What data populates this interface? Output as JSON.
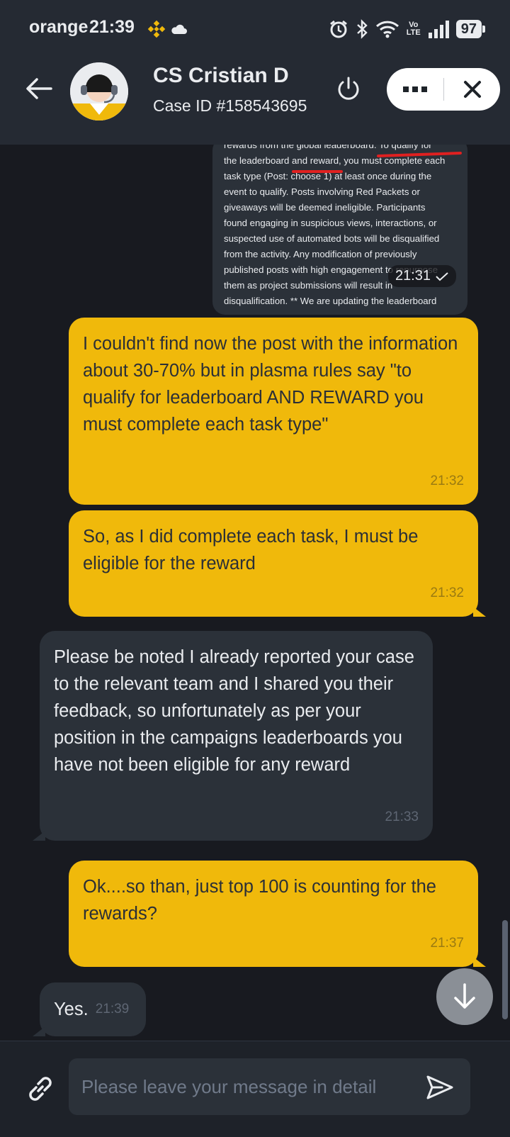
{
  "status_bar": {
    "carrier": "orange",
    "time": "21:39",
    "volte_line1": "Vo",
    "volte_line2": "LTE",
    "battery": "97",
    "icons": [
      "binance-icon",
      "cloud-icon",
      "alarm-icon",
      "bluetooth-icon",
      "wifi-icon",
      "signal-icon"
    ]
  },
  "header": {
    "agent_name": "CS Cristian D",
    "case_id": "Case ID #158543695",
    "icons": [
      "back-arrow-icon",
      "power-icon",
      "more-icon",
      "close-icon"
    ]
  },
  "messages": {
    "image_snippet": {
      "text": "rewards from the global leaderboard. To qualify for\nthe leaderboard and reward, you must complete each\ntask type (Post: choose 1) at least once during the\nevent to qualify. Posts involving Red Packets or\ngiveaways will be deemed ineligible. Participants\nfound engaging in suspicious views, interactions, or\nsuspected use of automated bots will be disqualified\nfrom the activity. Any modification of previously\npublished posts with high engagement to repurpose\nthem as project submissions will result in\ndisqualification. ** We are updating the leaderboard",
      "time": "21:31"
    },
    "m1": {
      "text": "I couldn't find now the post with the information about 30-70% but in plasma rules say \"to qualify for leaderboard AND REWARD you must complete each task type\"",
      "time": "21:32"
    },
    "m2": {
      "text": "So, as I did complete each task, I must be eligible for the reward",
      "time": "21:32"
    },
    "m3": {
      "text": "Please be noted I already reported your case to the relevant team and I shared you their feedback, so unfortunately as per your position in the campaigns leaderboards you have not been eligible for any reward",
      "time": "21:33"
    },
    "m4": {
      "text": "Ok....so than, just top 100 is counting for the rewards?",
      "time": "21:37"
    },
    "m5": {
      "text": "Yes.",
      "time": "21:39"
    }
  },
  "composer": {
    "placeholder": "Please leave your message in detail"
  },
  "colors": {
    "accent_yellow": "#f0b90b",
    "header_bg": "#252a33",
    "chat_bg": "#181a20",
    "incoming_bubble": "#2b3139"
  }
}
